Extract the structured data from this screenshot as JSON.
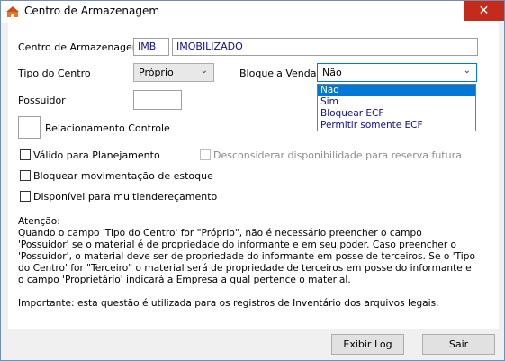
{
  "window": {
    "title": "Centro de Armazenagem",
    "close_glyph": "✕",
    "icon": "warehouse-app-icon"
  },
  "form": {
    "centro_label": "Centro de Armazenagem",
    "centro_code": "IMB",
    "centro_desc": "IMOBILIZADO",
    "tipo_label": "Tipo do Centro",
    "tipo_value": "Próprio",
    "bloqueia_label": "Bloqueia Venda",
    "bloqueia_value": "Não",
    "bloqueia_options": [
      "Não",
      "Sim",
      "Bloquear ECF",
      "Permitir somente ECF"
    ],
    "possuidor_label": "Possuidor",
    "possuidor_value": "",
    "relacionamento_label": "Relacionamento Controle",
    "valido_label": "Válido para Planejamento",
    "desconsiderar_label": "Desconsiderar disponibilidade para reserva futura",
    "bloquear_label": "Bloquear movimentação de estoque",
    "disponivel_label": "Disponível para multiendereçamento"
  },
  "notice": {
    "heading": "Atenção:",
    "line1": "Quando o campo 'Tipo do Centro' for \"Próprio\", não é necessário preencher o campo",
    "line2": "'Possuidor' se o material é de propriedade do informante e em seu poder. Caso preencher o",
    "line3": "'Possuidor', o material deve ser de propriedade do informante em posse de terceiros. Se o 'Tipo",
    "line4": "do Centro' for \"Terceiro\" o material será de propriedade de terceiros em posse do informante e",
    "line5": "o campo 'Proprietário' indicará a Empresa a qual pertence o material.",
    "important": "Importante: esta questão é utilizada para os registros de Inventário dos arquivos legais."
  },
  "buttons": {
    "log": "Exibir Log",
    "exit": "Sair"
  },
  "colors": {
    "selection": "#0078d7",
    "value_text": "#10108c",
    "close": "#c42b1c",
    "desktop": "#6fa3d6"
  }
}
